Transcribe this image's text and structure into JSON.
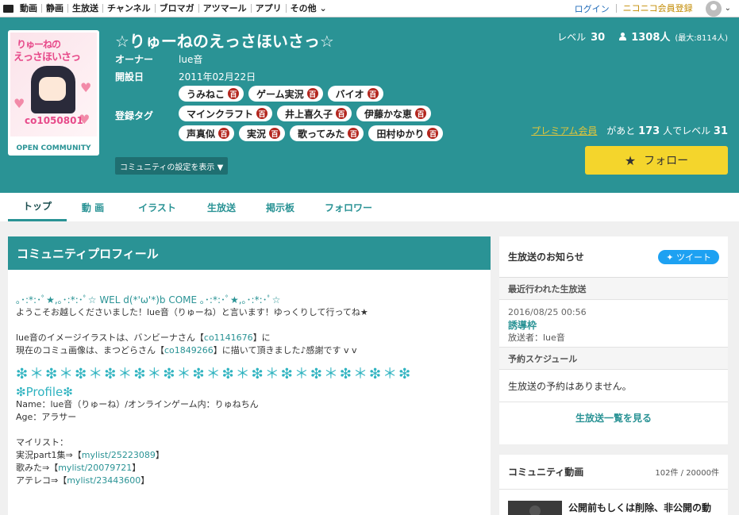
{
  "topnav": {
    "items": [
      "動画",
      "静画",
      "生放送",
      "チャンネル",
      "ブロマガ",
      "アツマール",
      "アプリ",
      "その他"
    ],
    "login": "ログイン",
    "register": "ニコニコ会員登録"
  },
  "community": {
    "title": "☆りゅーねのえっさほいさっ☆",
    "owner_label": "オーナー",
    "owner": "lue音",
    "established_label": "開設日",
    "established": "2011年02月22日",
    "tags_label": "登録タグ",
    "tag_rows": [
      [
        "うみねこ",
        "ゲーム実況",
        "バイオ"
      ],
      [
        "マインクラフト",
        "井上喜久子",
        "伊藤かな恵"
      ],
      [
        "声真似",
        "実況",
        "歌ってみた",
        "田村ゆかり"
      ]
    ],
    "tag_badge": "百",
    "settings_button": "コミュニティの設定を表示 ▼",
    "thumb": {
      "line1": "りゅーねの",
      "line2": "えっさほいさっ",
      "code": "co1050801",
      "open_label": "OPEN COMMUNITY"
    },
    "level_label": "レベル",
    "level": "30",
    "members": "1308人",
    "members_max": "(最大:8114人)",
    "premium_link": "プレミアム会員",
    "premium_pre": "があと",
    "premium_count": "173",
    "premium_mid": "人でレベル",
    "premium_next": "31",
    "follow_label": "フォロー"
  },
  "tabs": [
    "トップ",
    "動 画",
    "イラスト",
    "生放送",
    "掲示板",
    "フォロワー"
  ],
  "profile": {
    "heading": "コミュニティプロフィール",
    "welcome": "｡･:*:･ﾟ★,｡･:*:･ﾟ☆ WEL d(*'ω'*)b COME ｡･:*:･ﾟ★,｡･:*:･ﾟ☆",
    "line1": "ようこそお越しくださいました！lue音（りゅーね）と言います！ゆっくりして行ってね★",
    "line2a": "lue音のイメージイラストは、バンビーナさん【",
    "line2link": "co1141676",
    "line2b": "】に",
    "line3a": "現在のコミュ画像は、まつどらさん【",
    "line3link": "co1849266",
    "line3b": "】に描いて頂きました♪感謝です v v",
    "stars": "❇＊❇＊❇＊❇＊❇＊❇＊❇＊❇＊❇＊❇＊❇＊❇＊❇＊❇",
    "profile_title": "❇Profile❇",
    "name_line": "Name：lue音（りゅーね）/オンラインゲーム内：りゅねちん",
    "age_line": "Age：アラサー",
    "mylist_label": "マイリスト：",
    "m1a": "実況part1集⇒【",
    "m1link": "mylist/25223089",
    "m1b": "】",
    "m2a": "歌みた⇒【",
    "m2link": "mylist/20079721",
    "m2b": "】",
    "m3a": "アテレコ⇒【",
    "m3link": "mylist/23443600",
    "m3b": "】"
  },
  "live": {
    "heading": "生放送のお知らせ",
    "tweet": "ツイート",
    "recent_label": "最近行われた生放送",
    "date": "2016/08/25 00:56",
    "title": "誘導枠",
    "broadcaster": "放送者：lue音",
    "schedule_label": "予約スケジュール",
    "no_schedule": "生放送の予約はありません。",
    "see_list": "生放送一覧を見る"
  },
  "videos": {
    "heading": "コミュニティ動画",
    "count": "102件 / 20000件",
    "first_title": "公開前もしくは削除、非公開の動"
  },
  "colors": {
    "header_bg": "#2a9395",
    "follow_btn": "#f4d52c",
    "tweet": "#1da1f2"
  }
}
